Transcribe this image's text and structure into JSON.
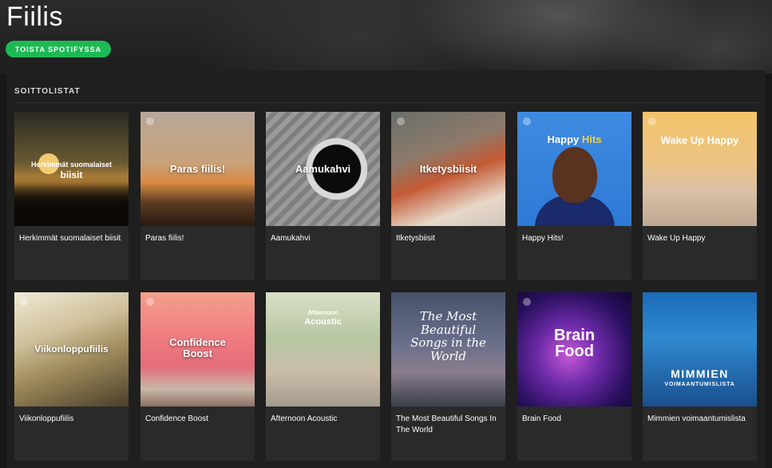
{
  "header": {
    "title": "Fiilis",
    "play_button_label": "TOISTA SPOTIFYSSA"
  },
  "section": {
    "label": "SOITTOLISTAT"
  },
  "playlists": [
    {
      "name": "Herkimmät suomalaiset biisit",
      "cover_line1": "Herkimmät suomalaiset",
      "cover_line2": "biisit"
    },
    {
      "name": "Paras fiilis!",
      "cover_text": "Paras fiilis!"
    },
    {
      "name": "Aamukahvi",
      "cover_text": "Aamukahvi"
    },
    {
      "name": "Itketysbiisit",
      "cover_text": "Itketysbiisit"
    },
    {
      "name": "Happy Hits!",
      "cover_word1": "Happy",
      "cover_word2": "Hits"
    },
    {
      "name": "Wake Up Happy",
      "cover_text": "Wake Up Happy"
    },
    {
      "name": "Viikonloppufiilis",
      "cover_text": "Viikonloppufiilis"
    },
    {
      "name": "Confidence Boost",
      "cover_text": "Confidence Boost"
    },
    {
      "name": "Afternoon Acoustic",
      "cover_line1": "Afternoon",
      "cover_line2": "Acoustic"
    },
    {
      "name": "The Most Beautiful Songs In The World",
      "cover_text": "The Most Beautiful Songs in the World"
    },
    {
      "name": "Brain Food",
      "cover_line1": "Brain",
      "cover_line2": "Food"
    },
    {
      "name": "Mimmien voimaantumislista",
      "cover_line1": "MIMMIEN",
      "cover_line2": "VOIMAANTUMISLISTA"
    }
  ],
  "colors": {
    "accent": "#1db954",
    "background": "#181818",
    "card": "#2a2a2a",
    "happy_hits_accent": "#f5d142"
  },
  "icons": [
    "spotify-logo-icon"
  ]
}
